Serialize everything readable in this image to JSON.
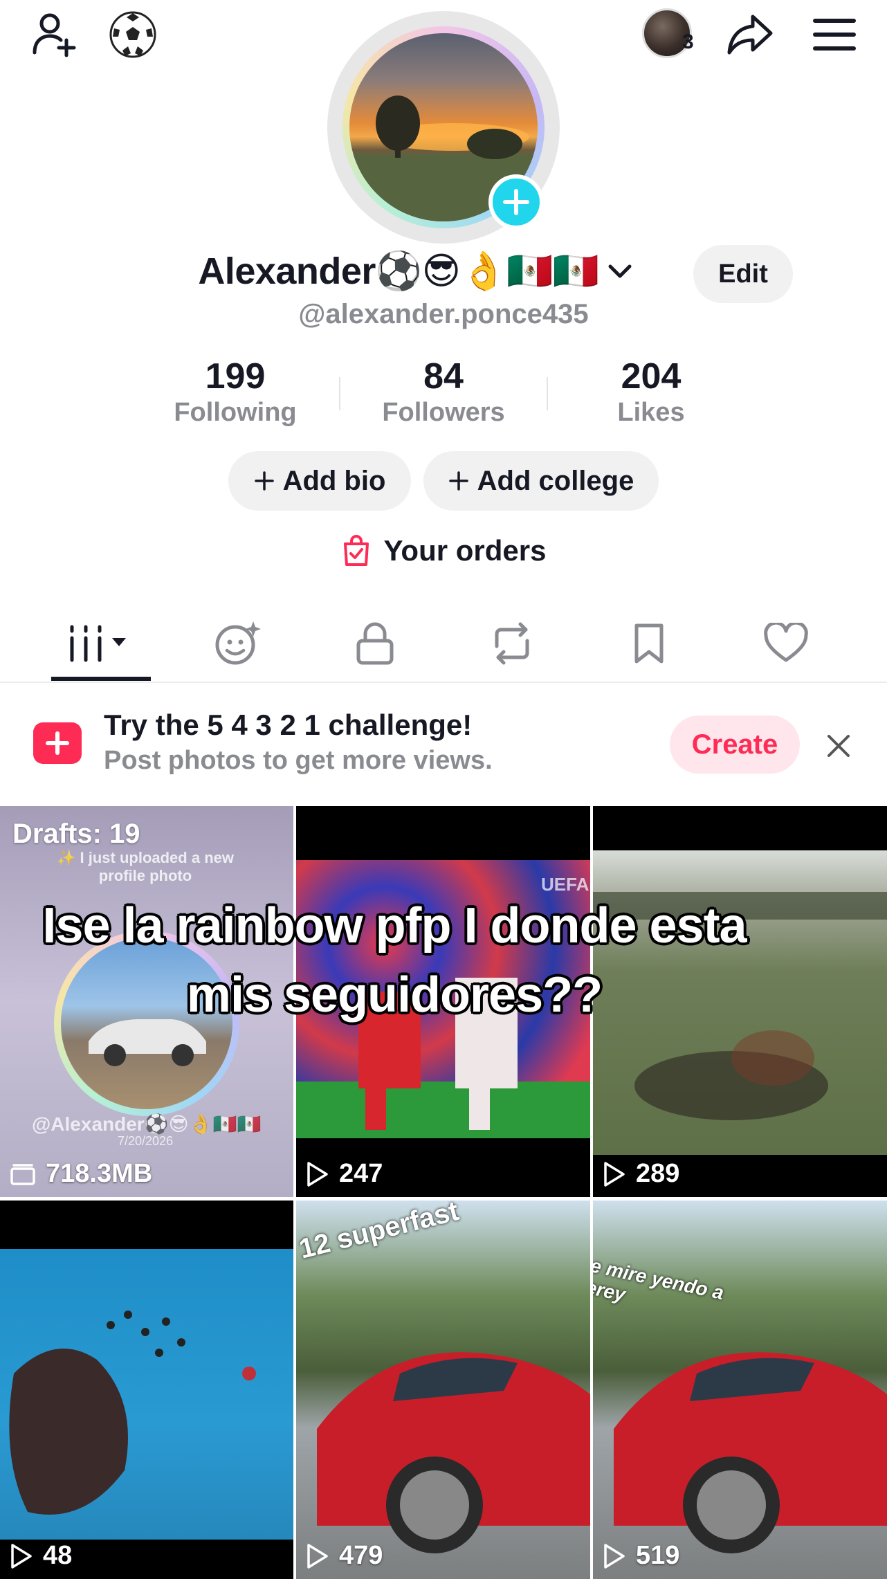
{
  "profile": {
    "display_name": "Alexander⚽😎👌🇲🇽🇲🇽",
    "handle": "@alexander.ponce435",
    "edit_label": "Edit",
    "story_count": "3"
  },
  "stats": [
    {
      "value": "199",
      "label": "Following"
    },
    {
      "value": "84",
      "label": "Followers"
    },
    {
      "value": "204",
      "label": "Likes"
    }
  ],
  "actions": {
    "add_bio": "Add bio",
    "add_college": "Add college",
    "your_orders": "Your orders"
  },
  "tabs": [
    "videos-icon",
    "reposts-face-icon",
    "private-lock-icon",
    "repost-icon",
    "bookmark-icon",
    "liked-heart-icon"
  ],
  "challenge": {
    "title": "Try the 5 4 3 2 1 challenge!",
    "subtitle": "Post photos to get more views.",
    "create_label": "Create"
  },
  "grid": {
    "drafts_label": "Drafts: 19",
    "drafts_size": "718.3MB",
    "draft_post_text": "✨ I just uploaded a new profile photo",
    "draft_post_handle": "@Alexander⚽😎👌🇲🇽🇲🇽",
    "draft_post_date": "7/20/2026",
    "caption_overlay": "Ise la rainbow pfp I donde esta mis seguidores??",
    "video_2_views": "247",
    "video_3_views": "289",
    "video_4_views": "48",
    "video_5_views": "479",
    "video_6_views": "519",
    "video_2_badge": "UEFA",
    "video_5_text": "12 superfast",
    "video_6_text": "e mire yendo a erey"
  },
  "colors": {
    "accent_pink": "#fe2c55",
    "accent_cyan": "#20d5ec",
    "text_primary": "#161823",
    "text_secondary": "#8a8b91"
  }
}
